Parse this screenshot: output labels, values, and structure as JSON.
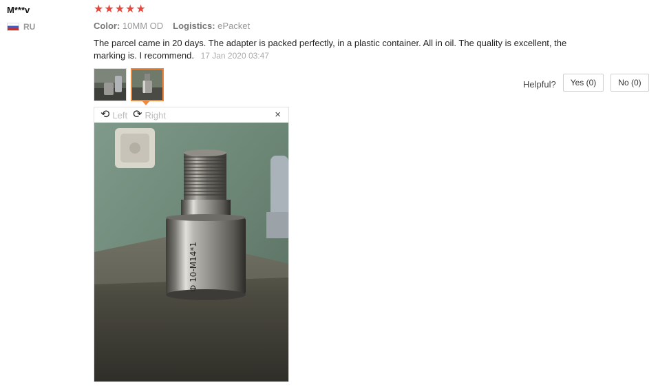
{
  "reviewer": {
    "name": "M***v",
    "country_code": "RU"
  },
  "rating": {
    "stars": 5,
    "max": 5
  },
  "attributes": {
    "color_label": "Color:",
    "color_value": "10MM OD",
    "logistics_label": "Logistics:",
    "logistics_value": "ePacket"
  },
  "review": {
    "text": "The parcel came in 20 days. The adapter is packed perfectly, in a plastic container. All in oil. The quality is excellent, the marking is. I recommend.",
    "date": "17 Jan 2020 03:47"
  },
  "helpful": {
    "label": "Helpful?",
    "yes_label": "Yes (0)",
    "no_label": "No (0)"
  },
  "viewer": {
    "rotate_left_label": "Left",
    "rotate_right_label": "Right",
    "close_glyph": "×"
  },
  "icons": {
    "star": "star-icon",
    "rotate_left": "rotate-left-icon",
    "rotate_right": "rotate-right-icon",
    "close": "close-icon",
    "flag": "russia-flag-icon"
  },
  "colors": {
    "star": "#e8483b",
    "active_thumb_border": "#f0883e"
  }
}
